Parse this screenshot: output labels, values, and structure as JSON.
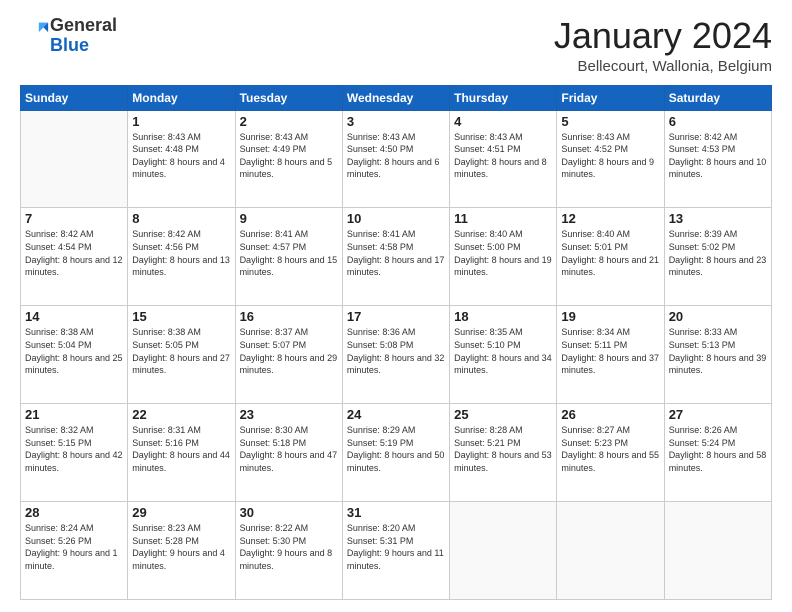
{
  "header": {
    "logo_general": "General",
    "logo_blue": "Blue",
    "month_title": "January 2024",
    "location": "Bellecourt, Wallonia, Belgium"
  },
  "days_of_week": [
    "Sunday",
    "Monday",
    "Tuesday",
    "Wednesday",
    "Thursday",
    "Friday",
    "Saturday"
  ],
  "weeks": [
    [
      {
        "day": "",
        "info": ""
      },
      {
        "day": "1",
        "info": "Sunrise: 8:43 AM\nSunset: 4:48 PM\nDaylight: 8 hours\nand 4 minutes."
      },
      {
        "day": "2",
        "info": "Sunrise: 8:43 AM\nSunset: 4:49 PM\nDaylight: 8 hours\nand 5 minutes."
      },
      {
        "day": "3",
        "info": "Sunrise: 8:43 AM\nSunset: 4:50 PM\nDaylight: 8 hours\nand 6 minutes."
      },
      {
        "day": "4",
        "info": "Sunrise: 8:43 AM\nSunset: 4:51 PM\nDaylight: 8 hours\nand 8 minutes."
      },
      {
        "day": "5",
        "info": "Sunrise: 8:43 AM\nSunset: 4:52 PM\nDaylight: 8 hours\nand 9 minutes."
      },
      {
        "day": "6",
        "info": "Sunrise: 8:42 AM\nSunset: 4:53 PM\nDaylight: 8 hours\nand 10 minutes."
      }
    ],
    [
      {
        "day": "7",
        "info": "Sunrise: 8:42 AM\nSunset: 4:54 PM\nDaylight: 8 hours\nand 12 minutes."
      },
      {
        "day": "8",
        "info": "Sunrise: 8:42 AM\nSunset: 4:56 PM\nDaylight: 8 hours\nand 13 minutes."
      },
      {
        "day": "9",
        "info": "Sunrise: 8:41 AM\nSunset: 4:57 PM\nDaylight: 8 hours\nand 15 minutes."
      },
      {
        "day": "10",
        "info": "Sunrise: 8:41 AM\nSunset: 4:58 PM\nDaylight: 8 hours\nand 17 minutes."
      },
      {
        "day": "11",
        "info": "Sunrise: 8:40 AM\nSunset: 5:00 PM\nDaylight: 8 hours\nand 19 minutes."
      },
      {
        "day": "12",
        "info": "Sunrise: 8:40 AM\nSunset: 5:01 PM\nDaylight: 8 hours\nand 21 minutes."
      },
      {
        "day": "13",
        "info": "Sunrise: 8:39 AM\nSunset: 5:02 PM\nDaylight: 8 hours\nand 23 minutes."
      }
    ],
    [
      {
        "day": "14",
        "info": "Sunrise: 8:38 AM\nSunset: 5:04 PM\nDaylight: 8 hours\nand 25 minutes."
      },
      {
        "day": "15",
        "info": "Sunrise: 8:38 AM\nSunset: 5:05 PM\nDaylight: 8 hours\nand 27 minutes."
      },
      {
        "day": "16",
        "info": "Sunrise: 8:37 AM\nSunset: 5:07 PM\nDaylight: 8 hours\nand 29 minutes."
      },
      {
        "day": "17",
        "info": "Sunrise: 8:36 AM\nSunset: 5:08 PM\nDaylight: 8 hours\nand 32 minutes."
      },
      {
        "day": "18",
        "info": "Sunrise: 8:35 AM\nSunset: 5:10 PM\nDaylight: 8 hours\nand 34 minutes."
      },
      {
        "day": "19",
        "info": "Sunrise: 8:34 AM\nSunset: 5:11 PM\nDaylight: 8 hours\nand 37 minutes."
      },
      {
        "day": "20",
        "info": "Sunrise: 8:33 AM\nSunset: 5:13 PM\nDaylight: 8 hours\nand 39 minutes."
      }
    ],
    [
      {
        "day": "21",
        "info": "Sunrise: 8:32 AM\nSunset: 5:15 PM\nDaylight: 8 hours\nand 42 minutes."
      },
      {
        "day": "22",
        "info": "Sunrise: 8:31 AM\nSunset: 5:16 PM\nDaylight: 8 hours\nand 44 minutes."
      },
      {
        "day": "23",
        "info": "Sunrise: 8:30 AM\nSunset: 5:18 PM\nDaylight: 8 hours\nand 47 minutes."
      },
      {
        "day": "24",
        "info": "Sunrise: 8:29 AM\nSunset: 5:19 PM\nDaylight: 8 hours\nand 50 minutes."
      },
      {
        "day": "25",
        "info": "Sunrise: 8:28 AM\nSunset: 5:21 PM\nDaylight: 8 hours\nand 53 minutes."
      },
      {
        "day": "26",
        "info": "Sunrise: 8:27 AM\nSunset: 5:23 PM\nDaylight: 8 hours\nand 55 minutes."
      },
      {
        "day": "27",
        "info": "Sunrise: 8:26 AM\nSunset: 5:24 PM\nDaylight: 8 hours\nand 58 minutes."
      }
    ],
    [
      {
        "day": "28",
        "info": "Sunrise: 8:24 AM\nSunset: 5:26 PM\nDaylight: 9 hours\nand 1 minute."
      },
      {
        "day": "29",
        "info": "Sunrise: 8:23 AM\nSunset: 5:28 PM\nDaylight: 9 hours\nand 4 minutes."
      },
      {
        "day": "30",
        "info": "Sunrise: 8:22 AM\nSunset: 5:30 PM\nDaylight: 9 hours\nand 8 minutes."
      },
      {
        "day": "31",
        "info": "Sunrise: 8:20 AM\nSunset: 5:31 PM\nDaylight: 9 hours\nand 11 minutes."
      },
      {
        "day": "",
        "info": ""
      },
      {
        "day": "",
        "info": ""
      },
      {
        "day": "",
        "info": ""
      }
    ]
  ]
}
